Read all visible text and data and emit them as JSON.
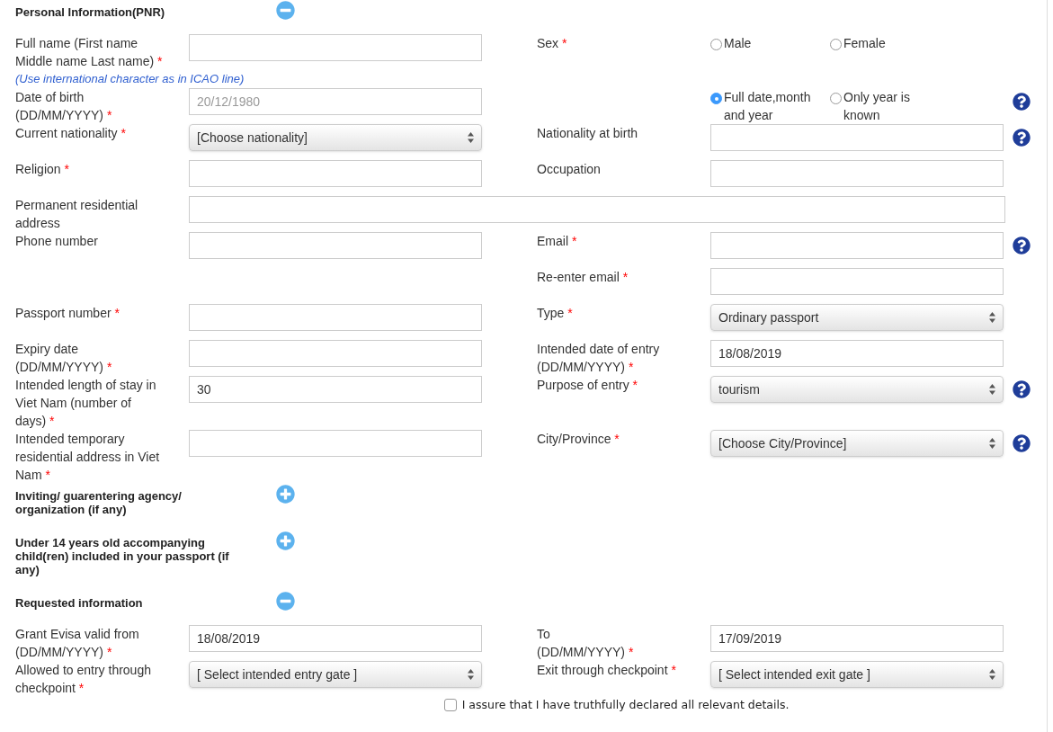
{
  "required_mark": "*",
  "sections": [
    {
      "title": "Personal Information(PNR)",
      "expanded": true,
      "rows": [
        {
          "left": {
            "label": "Full name (First name Middle name Last name)",
            "required": true,
            "hint": "(Use international character as in ICAO line)",
            "field": {
              "kind": "text"
            }
          },
          "right": {
            "label": "Sex",
            "required": true,
            "field": {
              "kind": "radio",
              "options": [
                {
                  "label": "Male",
                  "selected": false
                },
                {
                  "label": "Female",
                  "selected": false
                }
              ]
            }
          }
        },
        {
          "left": {
            "label": "Date of birth (DD/MM/YYYY)",
            "required": true,
            "field": {
              "kind": "text",
              "placeholder": "20/12/1980"
            }
          },
          "right": {
            "field": {
              "kind": "radio",
              "options": [
                {
                  "label": "Full date,month and year",
                  "selected": true
                },
                {
                  "label": "Only year is known",
                  "selected": false
                }
              ]
            },
            "help": true
          }
        },
        {
          "left": {
            "label": "Current nationality",
            "required": true,
            "field": {
              "kind": "select",
              "value": "[Choose nationality]"
            }
          },
          "right": {
            "label": "Nationality at birth",
            "required": false,
            "field": {
              "kind": "text"
            },
            "help": true
          }
        },
        {
          "left": {
            "label": "Religion",
            "required": true,
            "field": {
              "kind": "text"
            }
          },
          "right": {
            "label": "Occupation",
            "required": false,
            "field": {
              "kind": "text"
            }
          }
        },
        {
          "full": {
            "label": "Permanent residential address",
            "required": false,
            "field": {
              "kind": "text"
            }
          }
        },
        {
          "left": {
            "label": "Phone number",
            "required": false,
            "field": {
              "kind": "text"
            }
          },
          "right": {
            "label": "Email",
            "required": true,
            "field": {
              "kind": "text"
            },
            "help": true
          }
        },
        {
          "right": {
            "label": "Re-enter email",
            "required": true,
            "field": {
              "kind": "text"
            }
          }
        },
        {
          "left": {
            "label": "Passport number",
            "required": true,
            "field": {
              "kind": "text"
            }
          },
          "right": {
            "label": "Type",
            "required": true,
            "field": {
              "kind": "select",
              "value": "Ordinary passport"
            }
          }
        },
        {
          "left": {
            "label": "Expiry date (DD/MM/YYYY)",
            "required": true,
            "field": {
              "kind": "text"
            }
          },
          "right": {
            "label": "Intended date of entry (DD/MM/YYYY)",
            "required": true,
            "field": {
              "kind": "text",
              "value": "18/08/2019"
            }
          }
        },
        {
          "left": {
            "label": "Intended length of stay in Viet Nam (number of days)",
            "required": true,
            "field": {
              "kind": "text",
              "value": "30"
            }
          },
          "right": {
            "label": "Purpose of entry",
            "required": true,
            "field": {
              "kind": "select",
              "value": "tourism"
            },
            "help": true
          }
        },
        {
          "left": {
            "label": "Intended temporary residential address in Viet Nam",
            "required": true,
            "field": {
              "kind": "text"
            }
          },
          "right": {
            "label": "City/Province",
            "required": true,
            "field": {
              "kind": "select",
              "value": "[Choose City/Province]"
            },
            "help": true
          }
        }
      ]
    },
    {
      "title": "Inviting/ guarentering agency/ organization (if any)",
      "expanded": false
    },
    {
      "title": "Under 14 years old accompanying child(ren) included in your passport (if any)",
      "expanded": false
    },
    {
      "title": "Requested information",
      "expanded": true,
      "rows": [
        {
          "left": {
            "label": "Grant Evisa valid from (DD/MM/YYYY)",
            "required": true,
            "field": {
              "kind": "text",
              "value": "18/08/2019"
            }
          },
          "right": {
            "label": "To\n(DD/MM/YYYY)",
            "required": true,
            "field": {
              "kind": "text",
              "value": "17/09/2019"
            }
          }
        },
        {
          "left": {
            "label": "Allowed to entry through checkpoint",
            "required": true,
            "field": {
              "kind": "select",
              "value": "[ Select intended entry gate ]"
            }
          },
          "right": {
            "label": "Exit through checkpoint",
            "required": true,
            "field": {
              "kind": "select",
              "value": "[ Select intended exit gate ]"
            }
          }
        }
      ]
    }
  ],
  "declaration": {
    "text": "I assure that I have truthfully declared all relevant details.",
    "checked": false
  }
}
